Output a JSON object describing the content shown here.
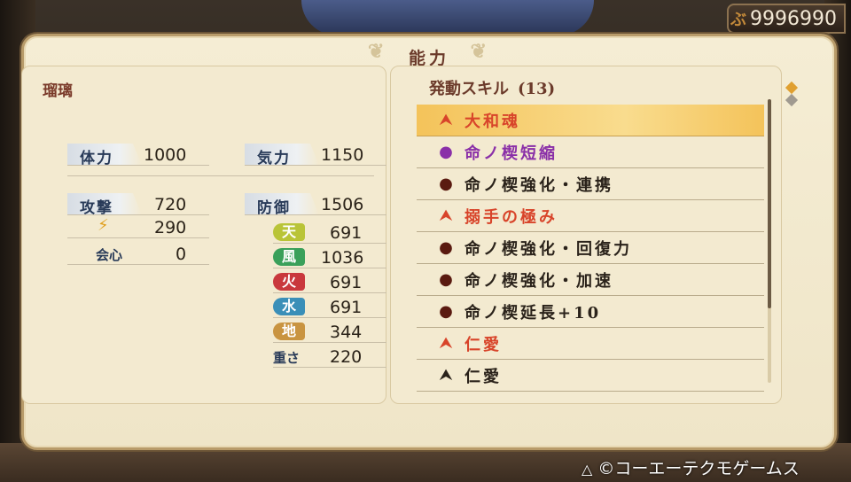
{
  "money": {
    "value": "9996990",
    "icon": "coin-icon"
  },
  "panel": {
    "title": "能力"
  },
  "character": {
    "name": "瑠璃"
  },
  "stats": {
    "hp_label": "体力",
    "hp": "1000",
    "ki_label": "気力",
    "ki": "1150",
    "atk_label": "攻撃",
    "atk": "720",
    "elem_atk": "290",
    "crit_label": "会心",
    "crit": "0",
    "def_label": "防御",
    "def": "1506",
    "weight_label": "重さ",
    "weight": "220"
  },
  "elements": [
    {
      "label": "天",
      "value": "691",
      "color": "#b9c437"
    },
    {
      "label": "風",
      "value": "1036",
      "color": "#3aa05a"
    },
    {
      "label": "火",
      "value": "691",
      "color": "#c9383c"
    },
    {
      "label": "水",
      "value": "691",
      "color": "#3a8fb8"
    },
    {
      "label": "地",
      "value": "344",
      "color": "#c99440"
    }
  ],
  "skills": {
    "header": "発動スキル",
    "count": "(13)",
    "items": [
      {
        "name": "大和魂",
        "icon": "chevron-up-red-icon",
        "color": "red",
        "selected": true
      },
      {
        "name": "命ノ楔短縮",
        "icon": "purple-orb-icon",
        "color": "purple"
      },
      {
        "name": "命ノ楔強化・連携",
        "icon": "dark-orb-icon",
        "color": "dark"
      },
      {
        "name": "搦手の極み",
        "icon": "chevron-up-red-icon",
        "color": "red"
      },
      {
        "name": "命ノ楔強化・回復力",
        "icon": "dark-orb-icon",
        "color": "dark"
      },
      {
        "name": "命ノ楔強化・加速",
        "icon": "dark-orb-icon",
        "color": "dark"
      },
      {
        "name": "命ノ楔延長+10",
        "icon": "dark-orb-icon",
        "color": "dark"
      },
      {
        "name": "仁愛",
        "icon": "chevron-up-red-icon",
        "color": "red"
      },
      {
        "name": "仁愛",
        "icon": "chevron-up-black-icon",
        "color": "dark"
      }
    ]
  },
  "footer": {
    "copyright": "©コーエーテクモゲームス",
    "button": "△"
  }
}
